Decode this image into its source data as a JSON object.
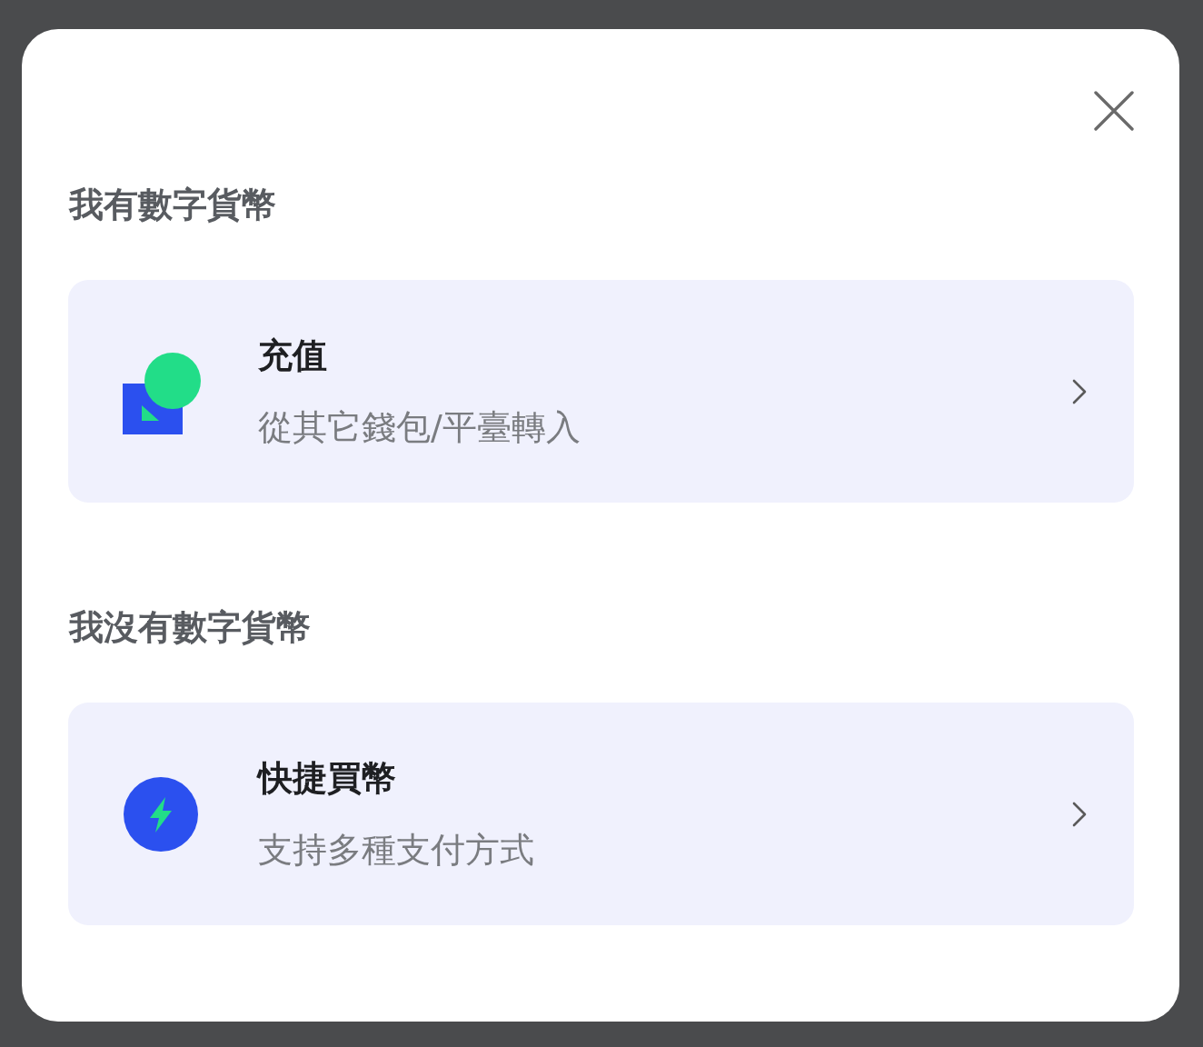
{
  "sections": [
    {
      "title": "我有數字貨幣",
      "options": [
        {
          "kind": "deposit",
          "title": "充值",
          "subtitle": "從其它錢包/平臺轉入"
        }
      ]
    },
    {
      "title": "我沒有數字貨幣",
      "options": [
        {
          "kind": "quick_buy",
          "title": "快捷買幣",
          "subtitle": "支持多種支付方式"
        }
      ]
    }
  ]
}
